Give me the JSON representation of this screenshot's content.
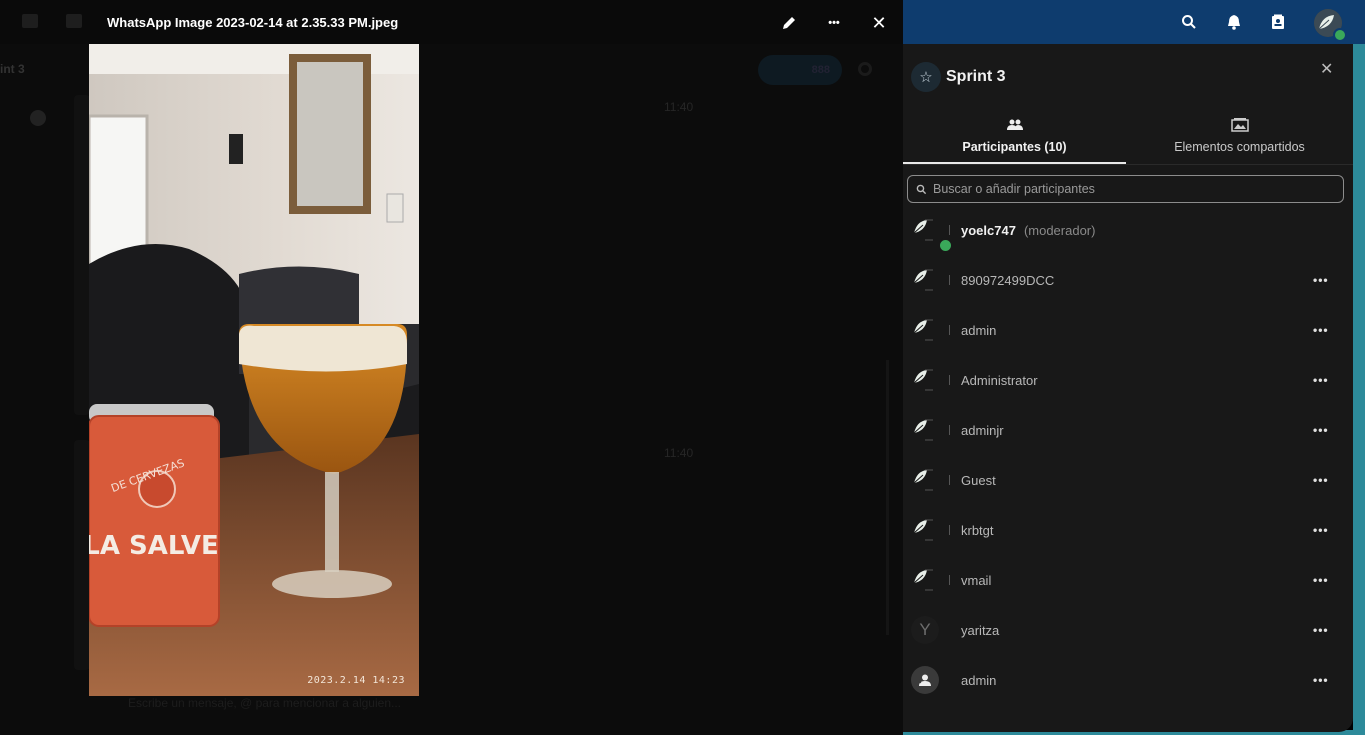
{
  "viewer": {
    "filename": "WhatsApp Image 2023-02-14 at 2.35.33 PM.jpeg",
    "photo_timestamp": "2023.2.14 14:23",
    "can_edit_label": "",
    "more_label": "•••",
    "close_label": "✕"
  },
  "background": {
    "room_name": "int 3",
    "call_label": "888",
    "time_1": "11:40",
    "time_2": "11:40",
    "composer_placeholder": "Escribe un mensaje, @ para mencionar a alguien..."
  },
  "sidebar": {
    "title": "Sprint 3",
    "close_label": "✕",
    "tabs": [
      {
        "label": "Participantes (10)",
        "icon": "people-icon",
        "active": true
      },
      {
        "label": "Elementos compartidos",
        "icon": "gallery-icon",
        "active": false
      }
    ],
    "search_placeholder": "Buscar o añadir participantes",
    "participants": [
      {
        "name": "yoelc747",
        "role": "(moderador)",
        "online": true,
        "avatar": "leaf"
      },
      {
        "name": "890972499DCC",
        "avatar": "leaf"
      },
      {
        "name": "admin",
        "avatar": "leaf"
      },
      {
        "name": "Administrator",
        "avatar": "leaf"
      },
      {
        "name": "adminjr",
        "avatar": "leaf"
      },
      {
        "name": "Guest",
        "avatar": "leaf"
      },
      {
        "name": "krbtgt",
        "avatar": "leaf"
      },
      {
        "name": "vmail",
        "avatar": "leaf"
      },
      {
        "name": "yaritza",
        "avatar": "letter",
        "initial": "Y"
      },
      {
        "name": "admin",
        "avatar": "group"
      }
    ],
    "more_label": "•••"
  },
  "colors": {
    "header_bar": "#0e3c6e",
    "sidebar_bg": "#181818",
    "accent_edge": "#2d8a9a",
    "online": "#3aa85a"
  }
}
